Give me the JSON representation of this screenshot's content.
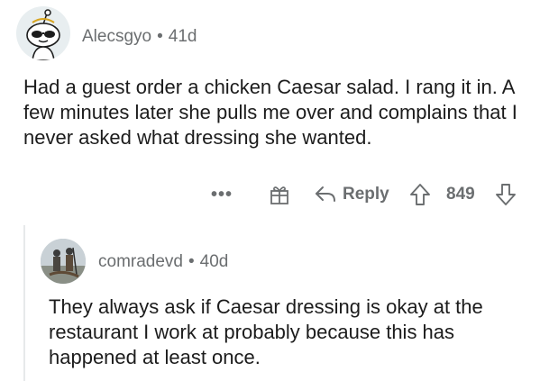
{
  "comments": [
    {
      "username": "Alecsgyo",
      "separator": "•",
      "age": "41d",
      "text": "Had a guest order a chicken Caesar salad. I rang it in. A few minutes later she pulls me over and complains that I never asked what dressing she wanted.",
      "actions": {
        "more_label": "•••",
        "reply_label": "Reply",
        "score": "849"
      }
    },
    {
      "username": "comradevd",
      "separator": "•",
      "age": "40d",
      "text": "They always ask if Caesar dressing is okay at the restaurant I work at probably because this has happened at least once."
    }
  ],
  "icons": {
    "avatar_1": "snoo-avatar-sunglasses",
    "avatar_2": "photo-avatar",
    "award": "gift-icon",
    "reply": "reply-arrow-icon",
    "upvote": "arrow-up-icon",
    "downvote": "arrow-down-icon"
  },
  "colors": {
    "meta_text": "#6b6e70",
    "body_text": "#1c1c1c",
    "thread_line": "#e7e9ea"
  }
}
